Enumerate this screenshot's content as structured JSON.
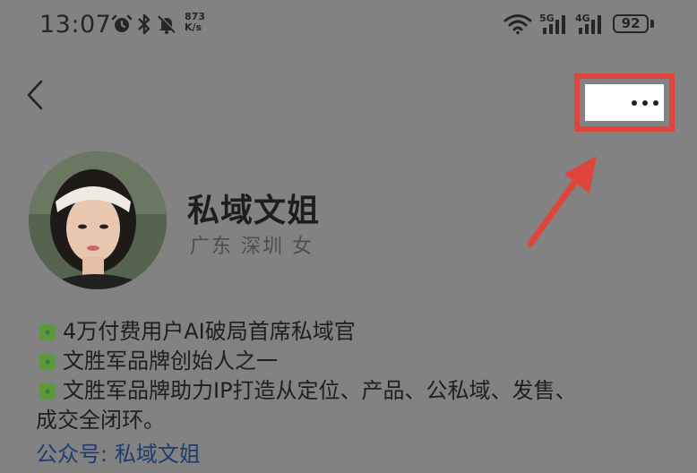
{
  "status_bar": {
    "time": "13:07",
    "net_speed_value": "873",
    "net_speed_unit": "K/s",
    "sim1_label": "5G",
    "sim2_label": "4G",
    "battery": "92",
    "icons": [
      "alarm-icon",
      "bluetooth-icon",
      "mute-icon",
      "wifi-icon",
      "signal-icon",
      "battery-icon"
    ]
  },
  "header": {
    "back_icon": "chevron-left-icon",
    "more_icon": "more-dots-icon",
    "highlight_color": "#e0453b"
  },
  "profile": {
    "name": "私域文姐",
    "region": "广东 深圳 女"
  },
  "bio": {
    "lines": [
      "4万付费用户AI破局首席私域官",
      "文胜军品牌创始人之一",
      "文胜军品牌助力IP打造从定位、产品、公私域、发售、",
      "成交全闭环。"
    ],
    "bullet_icon": "clover-icon"
  },
  "official_account": "公众号: 私域文姐"
}
